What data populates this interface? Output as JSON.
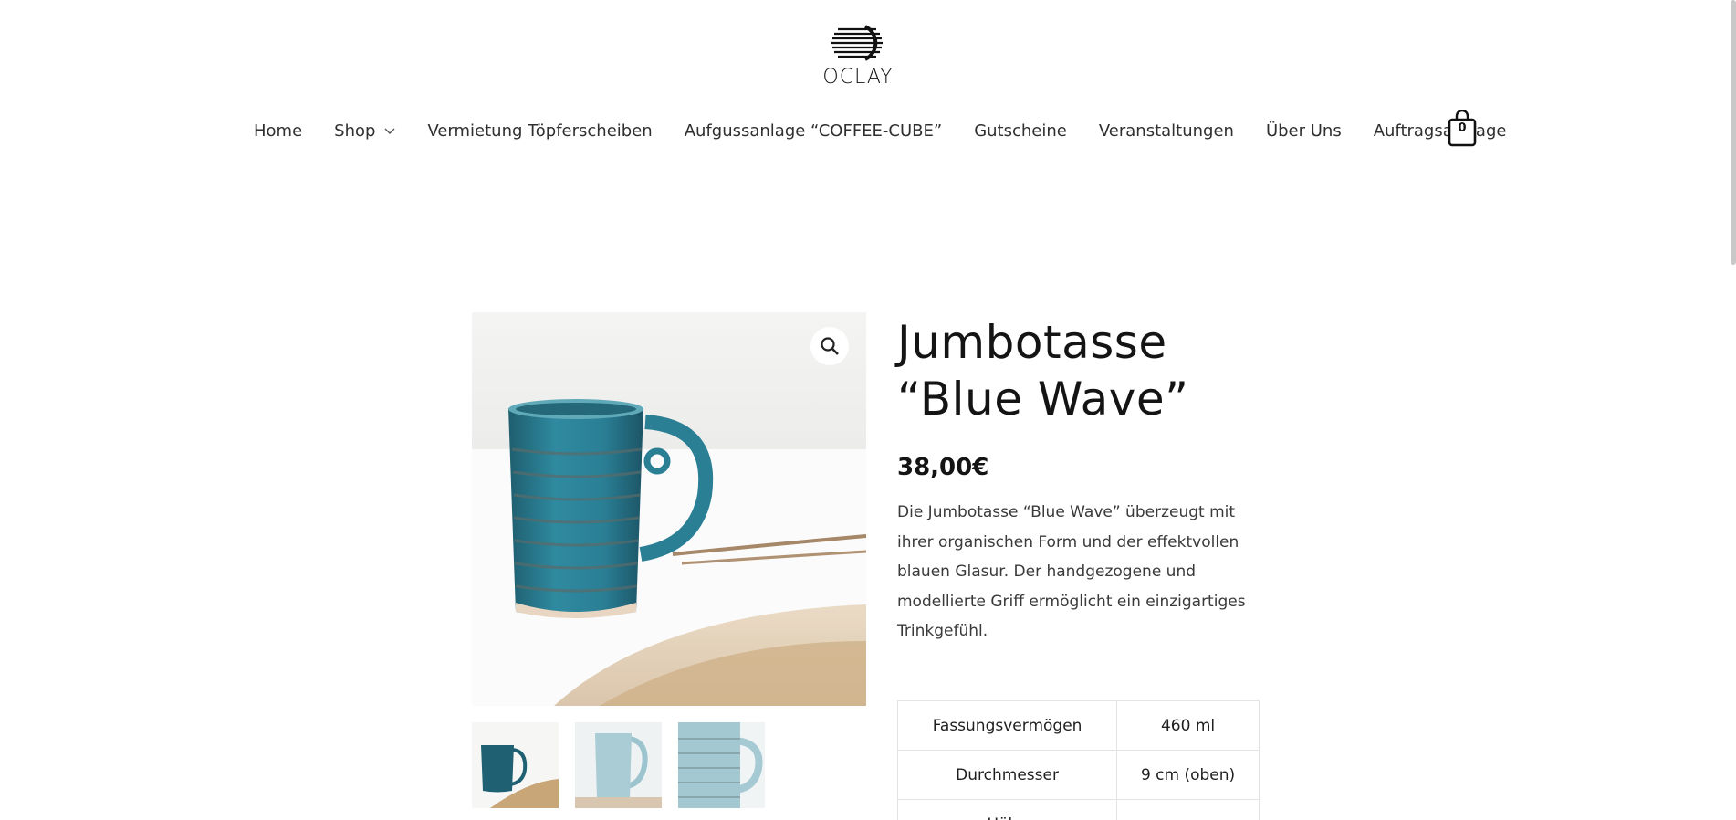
{
  "header": {
    "logo_text": "OCLAY",
    "cart_count": "0"
  },
  "nav": {
    "items": [
      {
        "label": "Home"
      },
      {
        "label": "Shop"
      },
      {
        "label": "Vermietung Töpferscheiben"
      },
      {
        "label": "Aufgussanlage “COFFEE-CUBE”"
      },
      {
        "label": "Gutscheine"
      },
      {
        "label": "Veranstaltungen"
      },
      {
        "label": "Über Uns"
      },
      {
        "label": "Auftragsanfrage"
      }
    ]
  },
  "product": {
    "title_line1": "Jumbotasse",
    "title_line2": "“Blue Wave”",
    "price": "38,00€",
    "description": "Die Jumbotasse “Blue Wave” überzeugt mit ihrer organischen Form und der effektvollen blauen Glasur. Der handgezogene und modellierte Griff ermöglicht ein einzigartiges Trinkgefühl.",
    "specs": [
      {
        "key": "Fassungsvermögen",
        "value": "460 ml"
      },
      {
        "key": "Durchmesser",
        "value": "9 cm (oben)"
      },
      {
        "key": "Höhe",
        "value": ""
      }
    ]
  },
  "icons": {
    "zoom": "magnifier-icon",
    "cart": "shopping-bag-icon",
    "shop_dropdown": "chevron-down-icon"
  },
  "colors": {
    "glaze_blue": "#2f7d92",
    "text": "#1b1b1b"
  }
}
